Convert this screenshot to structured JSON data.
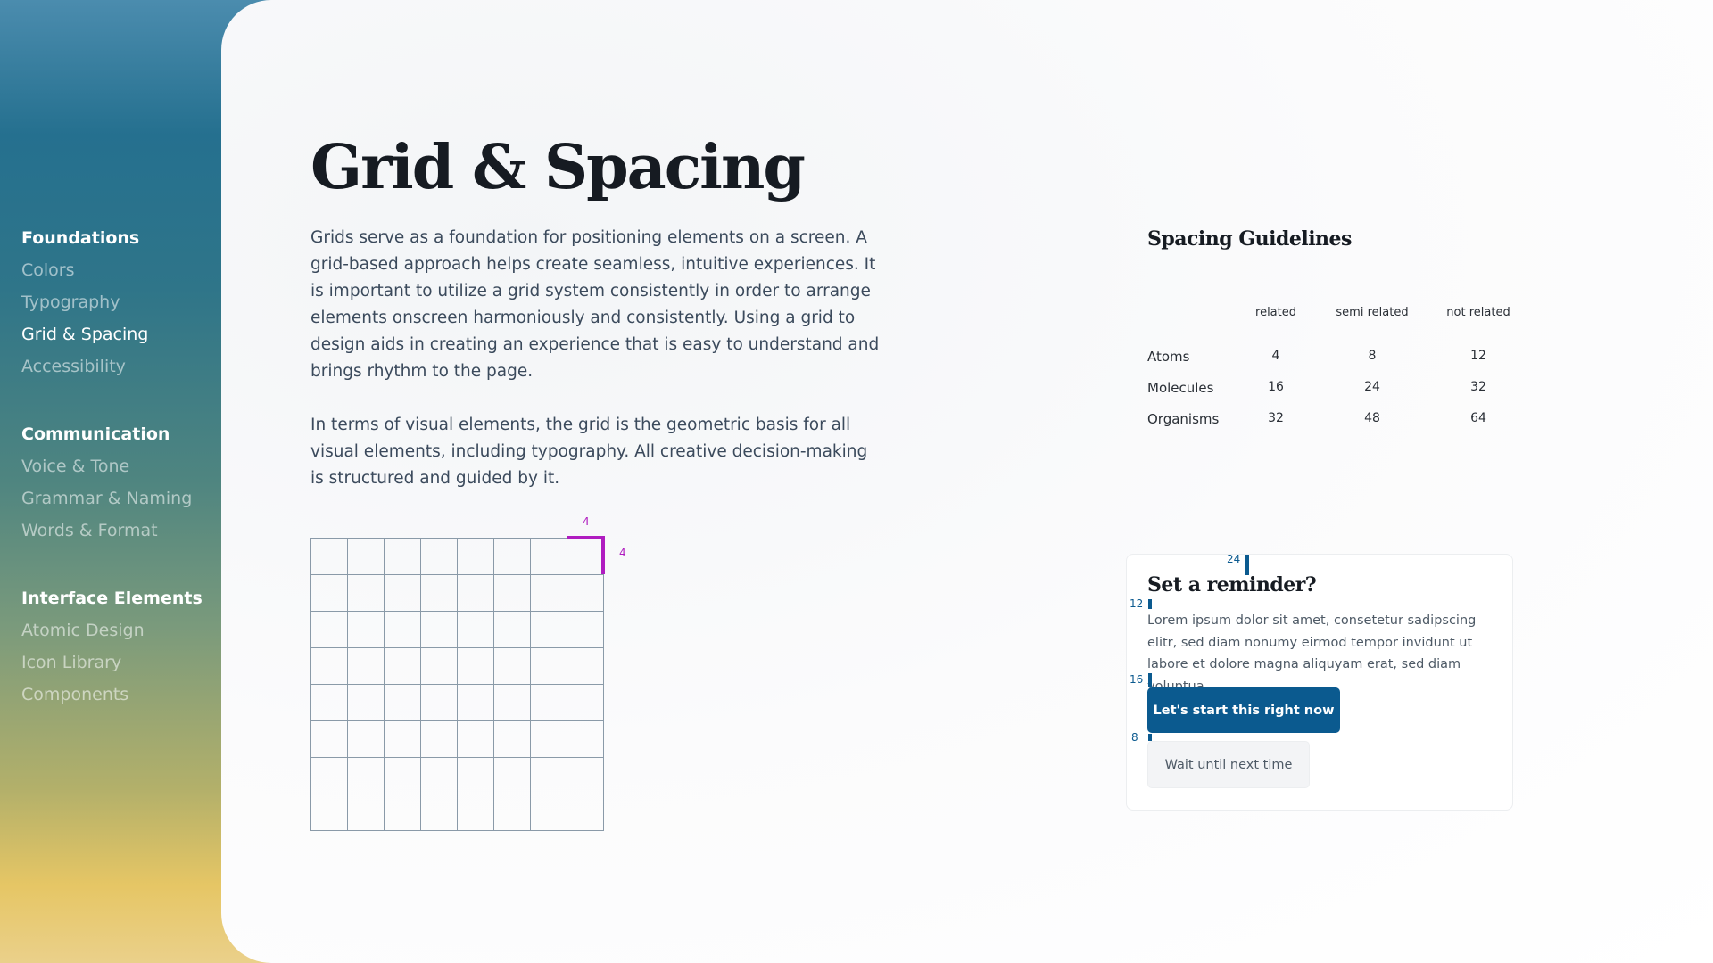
{
  "sidebar": {
    "groups": [
      {
        "title": "Foundations",
        "items": [
          "Colors",
          "Typography",
          "Grid & Spacing",
          "Accessibility"
        ]
      },
      {
        "title": "Communication",
        "items": [
          "Voice & Tone",
          "Grammar & Naming",
          "Words & Format"
        ]
      },
      {
        "title": "Interface Elements",
        "items": [
          "Atomic Design",
          "Icon Library",
          "Components"
        ]
      }
    ],
    "active_item": "Grid & Spacing"
  },
  "main": {
    "title": "Grid & Spacing",
    "paragraphs": [
      "Grids serve as a foundation for positioning elements on a screen. A grid-based approach helps create seamless, intuitive experiences. It is important to utilize a grid system consistently in order to arrange elements onscreen harmoniously and consistently. Using a grid to design aids in creating an experience that is easy to understand and brings rhythm to the page.",
      "In terms of visual elements, the grid is the geometric basis for all visual elements, including typography. All creative decision-making is structured and guided by it."
    ],
    "grid_demo": {
      "top_label": "4",
      "side_label": "4",
      "highlight_color": "#b01cc0"
    }
  },
  "spacing": {
    "title": "Spacing Guidelines",
    "columns": [
      "related",
      "semi related",
      "not related"
    ],
    "rows": [
      {
        "label": "Atoms",
        "values": [
          "4",
          "8",
          "12"
        ]
      },
      {
        "label": "Molecules",
        "values": [
          "16",
          "24",
          "32"
        ]
      },
      {
        "label": "Organisms",
        "values": [
          "32",
          "48",
          "64"
        ]
      }
    ]
  },
  "card": {
    "title": "Set a reminder?",
    "body": "Lorem ipsum dolor sit amet, consetetur sadipscing elitr, sed diam nonumy eirmod tempor invidunt ut labore et dolore magna aliquyam erat, sed diam voluptua.",
    "primary_label": "Let's start this right now",
    "secondary_label": "Wait until next time",
    "markers": {
      "top": "24",
      "title_body": "12",
      "body_button": "16",
      "button_gap": "8"
    },
    "accent": "#0b5a8f"
  }
}
